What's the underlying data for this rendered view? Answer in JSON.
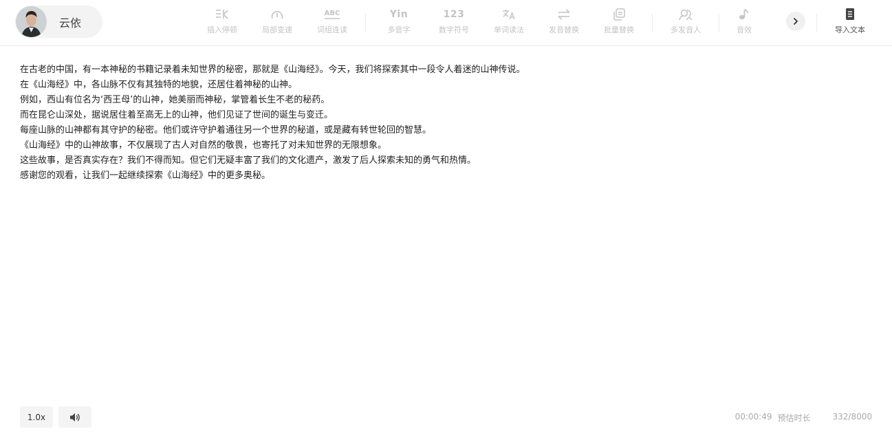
{
  "voice": {
    "name": "云依"
  },
  "toolbar": {
    "insert_pause": "插入停顿",
    "local_speed": "局部变速",
    "word_group": "词组连读",
    "polyphone_icon": "Yin",
    "polyphone": "多音字",
    "number_icon": "123",
    "number_symbol": "数字符号",
    "word_reading": "单词读法",
    "pronounce_replace": "发音替换",
    "batch_replace": "批量替换",
    "multi_speaker": "多发音人",
    "sound_effect": "音效",
    "import_text": "导入文本"
  },
  "editor": {
    "lines": [
      "在古老的中国，有一本神秘的书籍记录着未知世界的秘密，那就是《山海经》。今天，我们将探索其中一段令人着迷的山神传说。",
      "在《山海经》中，各山脉不仅有其独特的地貌，还居住着神秘的山神。",
      "例如，西山有位名为‘西王母’的山神，她美丽而神秘，掌管着长生不老的秘药。",
      "而在昆仑山深处，据说居住着至高无上的山神，他们见证了世间的诞生与变迁。",
      "每座山脉的山神都有其守护的秘密。他们或许守护着通往另一个世界的秘道，或是藏有转世轮回的智慧。",
      "《山海经》中的山神故事，不仅展现了古人对自然的敬畏，也寄托了对未知世界的无限想象。",
      "这些故事，是否真实存在？我们不得而知。但它们无疑丰富了我们的文化遗产，激发了后人探索未知的勇气和热情。",
      "感谢您的观看，让我们一起继续探索《山海经》中的更多奥秘。"
    ]
  },
  "footer": {
    "speed": "1.0x",
    "duration": "00:00:49",
    "duration_label": "预估时长",
    "char_count": "332/8000"
  },
  "icons": {
    "pause": "insert-pause-icon",
    "speed": "speedometer-icon",
    "abc": "abc-underline-icon",
    "translate": "translate-icon",
    "swap": "swap-arrows-icon",
    "batch": "copy-stack-icon",
    "speakers": "multi-speaker-icon",
    "music": "music-note-icon",
    "doc": "document-icon",
    "volume": "volume-icon",
    "chevron": "chevron-right-icon"
  },
  "colors": {
    "icon_disabled": "#c4c4c4",
    "text": "#222222",
    "pill_bg": "#f3f3f3"
  }
}
